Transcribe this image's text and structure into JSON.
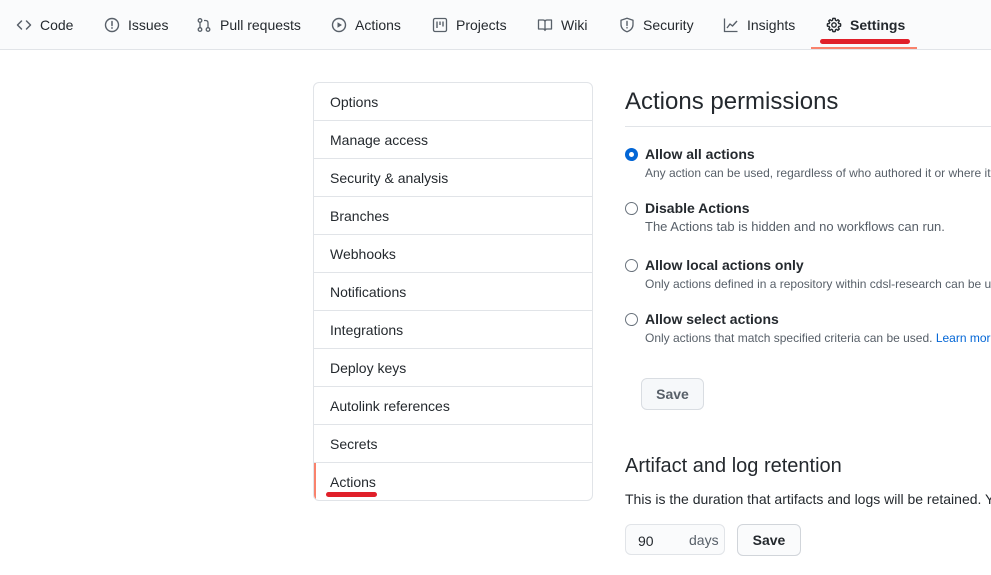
{
  "nav": {
    "tabs": [
      {
        "label": "Code",
        "icon": "code-icon"
      },
      {
        "label": "Issues",
        "icon": "issue-opened-icon"
      },
      {
        "label": "Pull requests",
        "icon": "git-pull-request-icon"
      },
      {
        "label": "Actions",
        "icon": "play-icon"
      },
      {
        "label": "Projects",
        "icon": "project-icon"
      },
      {
        "label": "Wiki",
        "icon": "book-icon"
      },
      {
        "label": "Security",
        "icon": "shield-icon"
      },
      {
        "label": "Insights",
        "icon": "graph-icon"
      },
      {
        "label": "Settings",
        "icon": "gear-icon",
        "selected": true
      }
    ],
    "selected_color": "#f9826c"
  },
  "menu": {
    "items": [
      {
        "label": "Options"
      },
      {
        "label": "Manage access"
      },
      {
        "label": "Security & analysis"
      },
      {
        "label": "Branches"
      },
      {
        "label": "Webhooks"
      },
      {
        "label": "Notifications"
      },
      {
        "label": "Integrations"
      },
      {
        "label": "Deploy keys"
      },
      {
        "label": "Autolink references"
      },
      {
        "label": "Secrets"
      },
      {
        "label": "Actions",
        "selected": true
      }
    ]
  },
  "permissions": {
    "title": "Actions permissions",
    "options": [
      {
        "label": "Allow all actions",
        "description": "Any action can be used, regardless of who authored it or where it",
        "checked": true
      },
      {
        "label": "Disable Actions",
        "description": "The Actions tab is hidden and no workflows can run.",
        "checked": false
      },
      {
        "label": "Allow local actions only",
        "description": "Only actions defined in a repository within cdsl-research can be us",
        "checked": false
      },
      {
        "label": "Allow select actions",
        "description": "Only actions that match specified criteria can be used.",
        "link": "Learn more",
        "checked": false
      }
    ],
    "save_label": "Save"
  },
  "retention": {
    "title": "Artifact and log retention",
    "description": "This is the duration that artifacts and logs will be retained. Y",
    "days_value": "90",
    "days_suffix": "days",
    "save_label": "Save"
  },
  "colors": {
    "accent_blue": "#0366d6",
    "annotation_red": "#e0202a"
  }
}
